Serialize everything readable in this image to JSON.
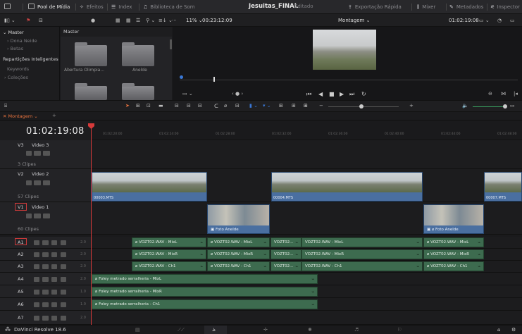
{
  "topbar": {
    "media_pool": "Pool de Mídia",
    "effects": "Efeitos",
    "index": "Index",
    "sound_library": "Biblioteca de Som",
    "project_title": "Jesuitas_FINAL",
    "project_status": "Editado",
    "quick_export": "Exportação Rápida",
    "mixer": "Mixer",
    "metadata": "Metadados",
    "inspector": "Inspector"
  },
  "row2": {
    "zoom": "11%",
    "source_tc": "00:23:12:09",
    "timeline_name": "Montagem",
    "record_tc": "01:02:19:08"
  },
  "sidebar": {
    "items": [
      "Master",
      "Dona Neide",
      "Betas",
      "Repartições Inteligentes",
      "Keywords",
      "Coleções"
    ]
  },
  "bin": {
    "header": "Master",
    "folders": [
      "Abertura Olimpia...",
      "Anelde",
      "",
      ""
    ]
  },
  "timeline": {
    "tab": "Montagem",
    "timecode": "01:02:19:08",
    "ruler": [
      "01:02:20:00",
      "01:02:24:00",
      "01:02:28:00",
      "01:02:32:00",
      "01:02:36:00",
      "01:02:40:00",
      "01:02:44:00",
      "01:02:48:00"
    ]
  },
  "tracks": {
    "v3": {
      "id": "V3",
      "name": "Video 3",
      "clips": "3 Clipes"
    },
    "v2": {
      "id": "V2",
      "name": "Video 2",
      "clips": "57 Clipes"
    },
    "v1": {
      "id": "V1",
      "name": "Video 1",
      "clips": "60 Clipes"
    },
    "audio": [
      {
        "id": "A1",
        "vol": "2.0"
      },
      {
        "id": "A2",
        "vol": "2.0"
      },
      {
        "id": "A3",
        "vol": "2.0"
      },
      {
        "id": "A4",
        "vol": "2.0"
      },
      {
        "id": "A5",
        "vol": "1.0"
      },
      {
        "id": "A6",
        "vol": "1.0"
      },
      {
        "id": "A7",
        "vol": "2.0"
      }
    ]
  },
  "clips": {
    "v2_1": "00003.MTS",
    "v2_2": "00004.MTS",
    "v2_3": "00007.MTS",
    "v1_1": "Foto Anelde",
    "v1_2": "Foto Anelde",
    "a_mixl": "VOZT02.WAV - MixL",
    "a_mixr": "VOZT02.WAV - MixR",
    "a_ch1": "VOZT02.WAV - Ch1",
    "a_short": "VOZT02...",
    "foley_mixl": "Foley metrado serralheria - MixL",
    "foley_mixr": "Foley metrado serralheria - MixR",
    "foley_ch1": "Foley metrado serralheria - Ch1"
  },
  "bottom": {
    "brand": "DaVinci Resolve 18.6"
  },
  "colors": {
    "video_clip": "#4a6fa0",
    "audio_clip": "#3d6b4f",
    "playhead": "#d63a3a",
    "accent": "#e8733e"
  }
}
